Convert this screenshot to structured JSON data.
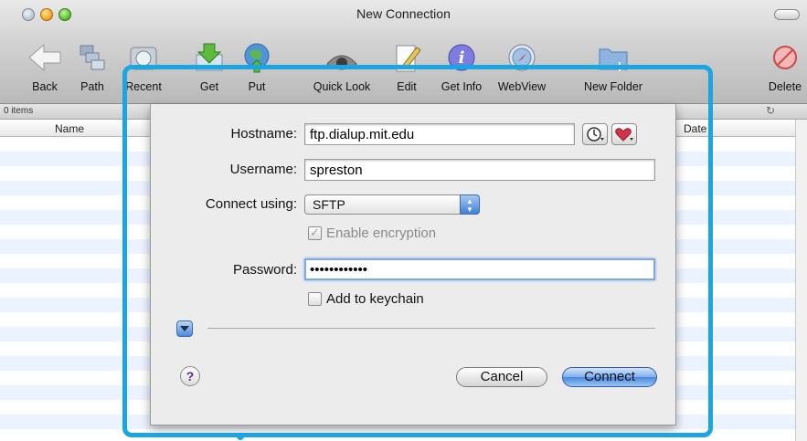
{
  "window": {
    "title": "New Connection",
    "item_count": "0 items"
  },
  "toolbar": [
    {
      "id": "back",
      "label": "Back",
      "icon": "back-arrow-icon"
    },
    {
      "id": "path",
      "label": "Path",
      "icon": "path-icon"
    },
    {
      "id": "recent",
      "label": "Recent",
      "icon": "recent-icon"
    },
    {
      "id": "get",
      "label": "Get",
      "icon": "download-icon"
    },
    {
      "id": "put",
      "label": "Put",
      "icon": "upload-icon"
    },
    {
      "id": "quicklook",
      "label": "Quick Look",
      "icon": "eye-icon"
    },
    {
      "id": "edit",
      "label": "Edit",
      "icon": "pencil-icon"
    },
    {
      "id": "getinfo",
      "label": "Get Info",
      "icon": "info-icon"
    },
    {
      "id": "webview",
      "label": "WebView",
      "icon": "compass-icon"
    },
    {
      "id": "newfolder",
      "label": "New Folder",
      "icon": "folder-icon"
    },
    {
      "id": "delete",
      "label": "Delete",
      "icon": "delete-icon"
    }
  ],
  "columns": {
    "name": "Name",
    "date": "Date"
  },
  "dialog": {
    "hostname_label": "Hostname:",
    "hostname_value": "ftp.dialup.mit.edu",
    "username_label": "Username:",
    "username_value": "spreston",
    "connect_label": "Connect using:",
    "protocol": "SFTP",
    "encryption_label": "Enable encryption",
    "encryption_checked": true,
    "password_label": "Password:",
    "password_value": "••••••••••••",
    "keychain_label": "Add to keychain",
    "keychain_checked": false,
    "help": "?",
    "cancel": "Cancel",
    "connect": "Connect"
  },
  "colors": {
    "accent": "#1aa5e3",
    "focus": "#7fa9e6",
    "stripe": "#edf3fe"
  }
}
